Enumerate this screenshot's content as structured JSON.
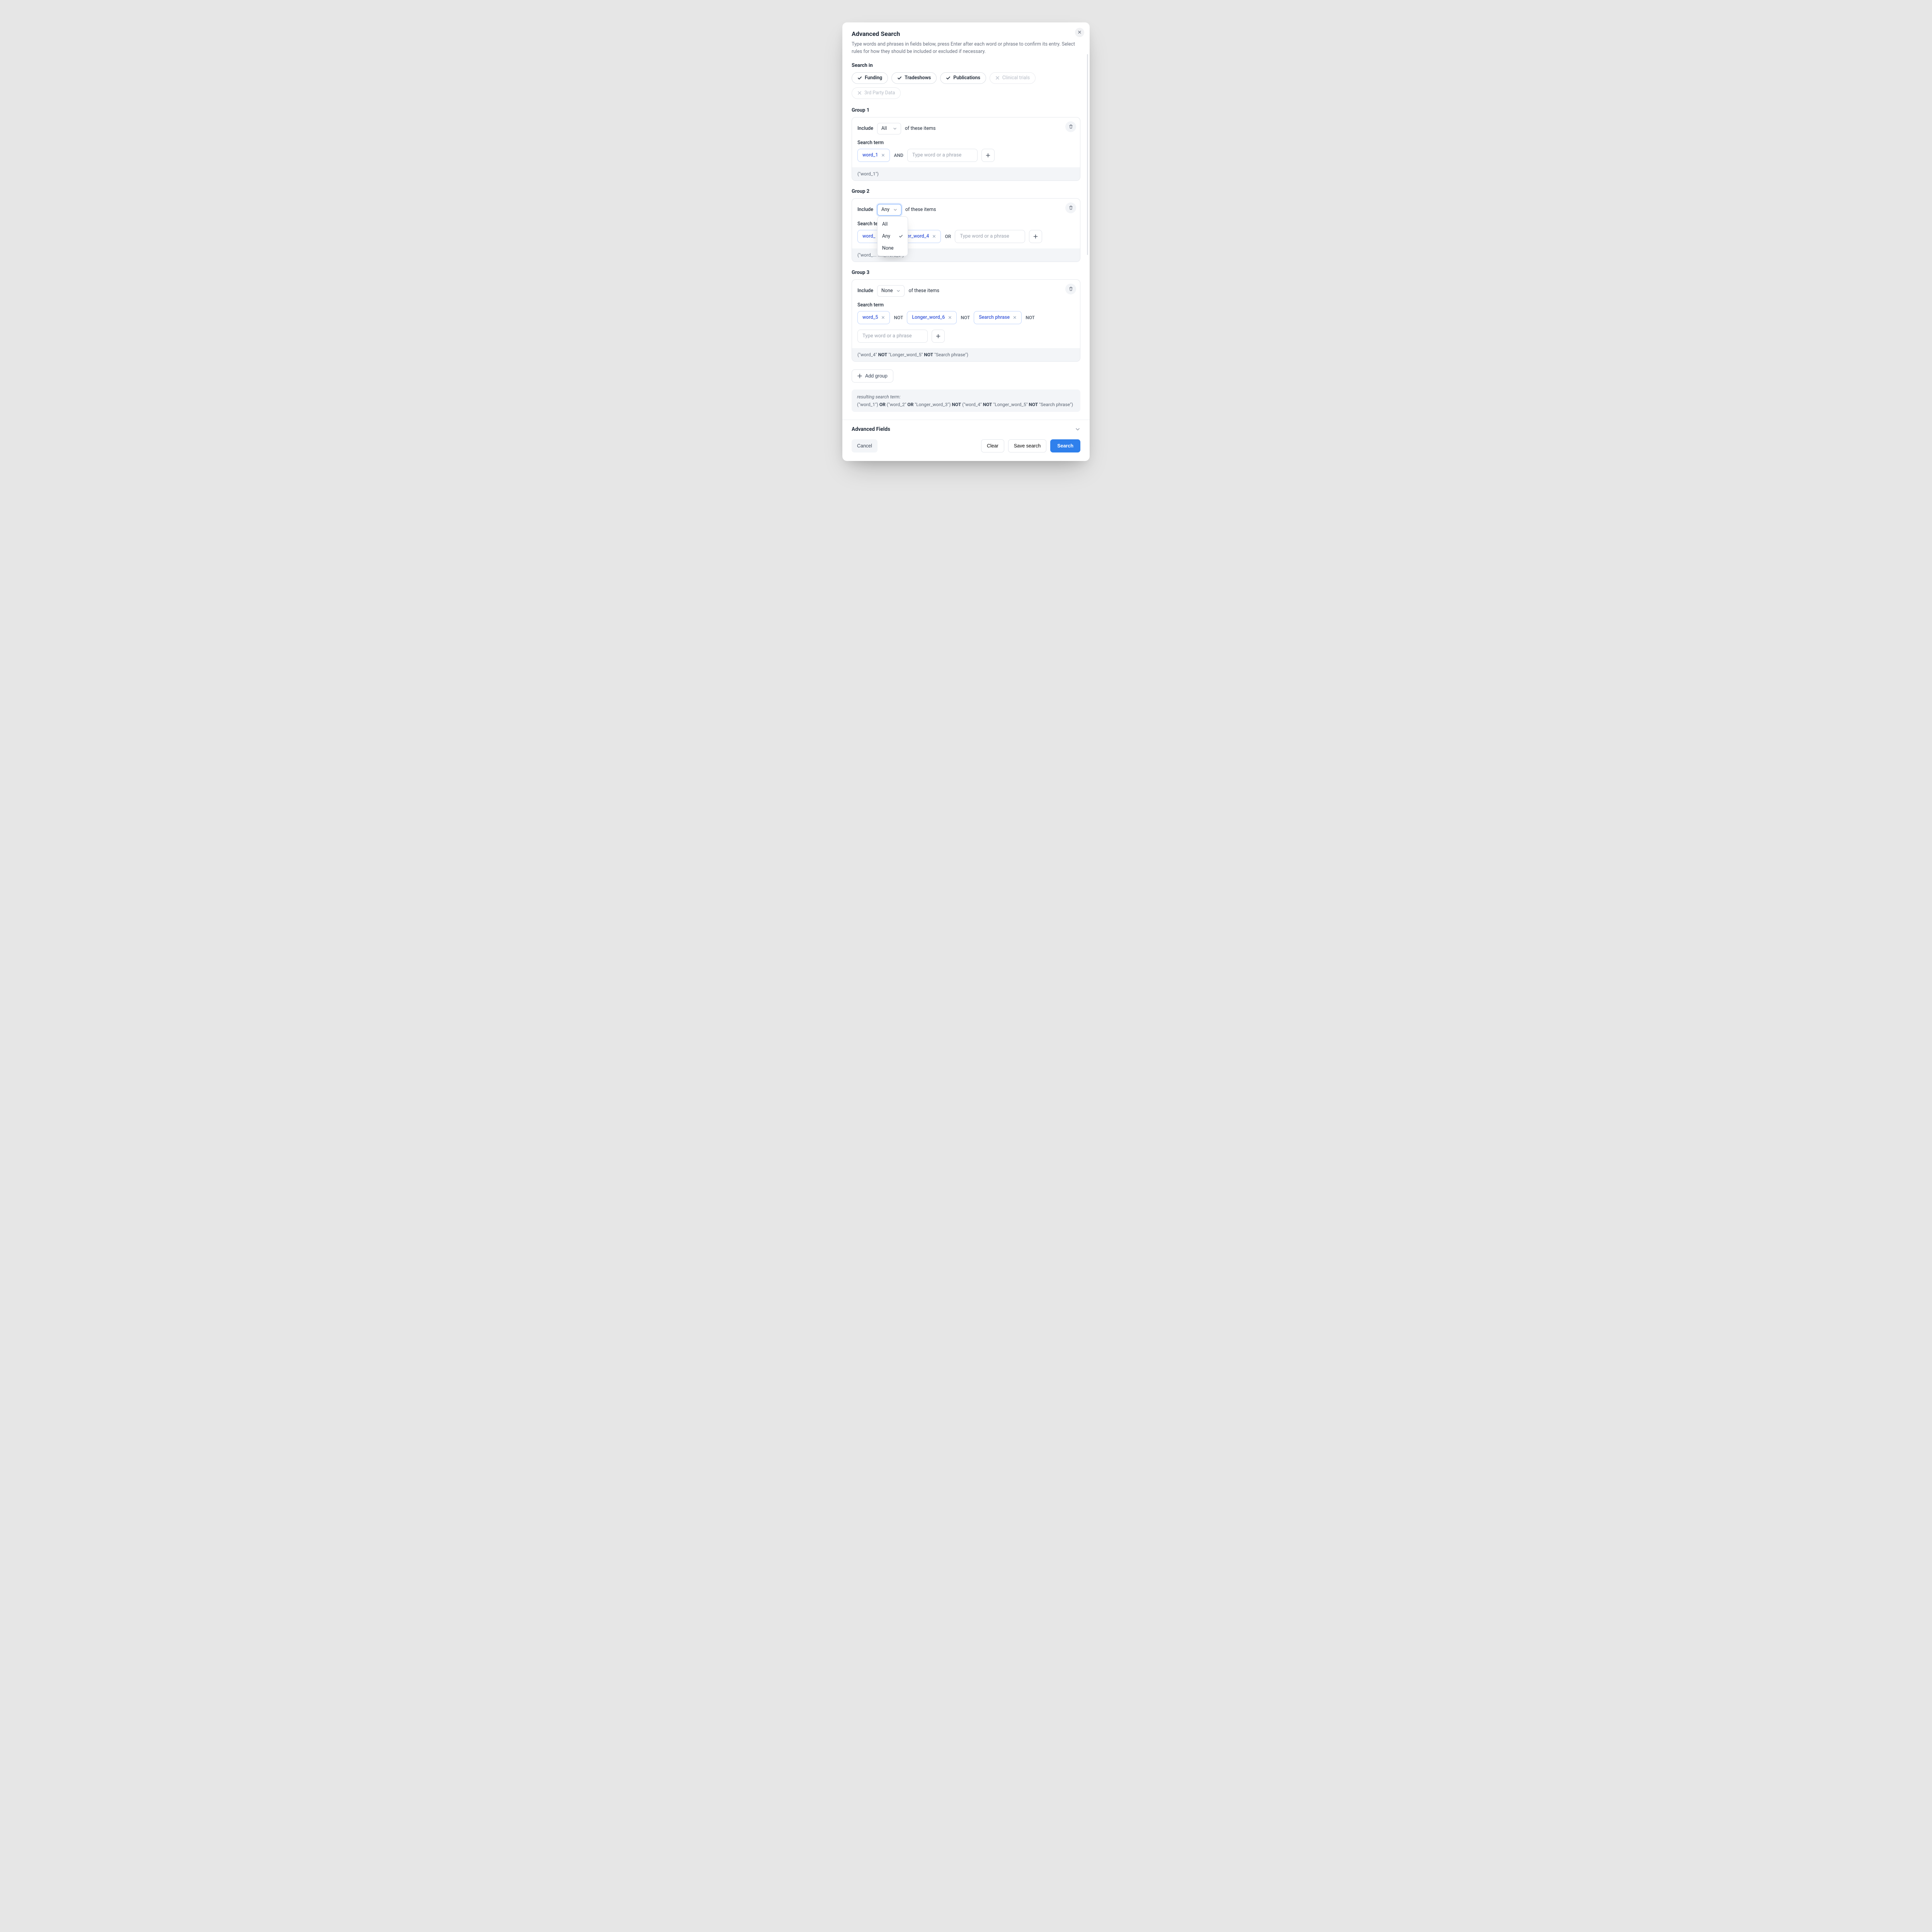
{
  "header": {
    "title": "Advanced Search",
    "subtitle": "Type words and phrases in fields below, press Enter after each word or phrase to confirm its entry. Select rules for how they should be included or excluded if necessary."
  },
  "search_in": {
    "label": "Search in",
    "options": [
      {
        "label": "Funding",
        "selected": true
      },
      {
        "label": "Tradeshows",
        "selected": true
      },
      {
        "label": "Publications",
        "selected": true
      },
      {
        "label": "Clinical trials",
        "selected": false
      },
      {
        "label": "3rd Party Data",
        "selected": false
      }
    ]
  },
  "include_label": "Include",
  "of_items_label": "of these items",
  "search_term_label": "Search term",
  "input_placeholder": "Type word or a phrase",
  "dropdown_options": [
    "All",
    "Any",
    "None"
  ],
  "groups": [
    {
      "title": "Group 1",
      "selector": "All",
      "selector_open": false,
      "terms": [
        {
          "text": "word_1",
          "op_after": "AND"
        }
      ],
      "show_add": true,
      "summary_html": "(\"word_1\")"
    },
    {
      "title": "Group 2",
      "selector": "Any",
      "selector_open": true,
      "terms": [
        {
          "text": "word_",
          "op_after": ""
        },
        {
          "text": "Longer_word_4",
          "op_after": "OR"
        }
      ],
      "show_add": true,
      "summary_html": "(\"word_2\" OR \"Longer_word_3\")",
      "summary_visible": "(\"word_... ....._word_3\")"
    },
    {
      "title": "Group 3",
      "selector": "None",
      "selector_open": false,
      "terms": [
        {
          "text": "word_5",
          "op_after": "NOT"
        },
        {
          "text": "Longer_word_6",
          "op_after": "NOT"
        },
        {
          "text": "Search phrase",
          "op_after": "NOT"
        }
      ],
      "show_add": true,
      "summary_parts": [
        "(\"word_4\" ",
        "NOT",
        " \"Longer_word_5\" ",
        "NOT",
        " \"Search phrase\")"
      ]
    }
  ],
  "add_group_label": "Add group",
  "result": {
    "label": "resulting search term:",
    "parts": [
      "(\"word_1\") ",
      "OR",
      " (\"word_2\" ",
      "OR",
      " \"Longer_word_3\") ",
      "NOT",
      " (\"word_4\" ",
      "NOT",
      " \"Longer_word_5\" ",
      "NOT",
      " \"Search phrase\")"
    ]
  },
  "advanced_fields_label": "Advanced Fields",
  "footer": {
    "cancel": "Cancel",
    "clear": "Clear",
    "save": "Save search",
    "search": "Search"
  }
}
